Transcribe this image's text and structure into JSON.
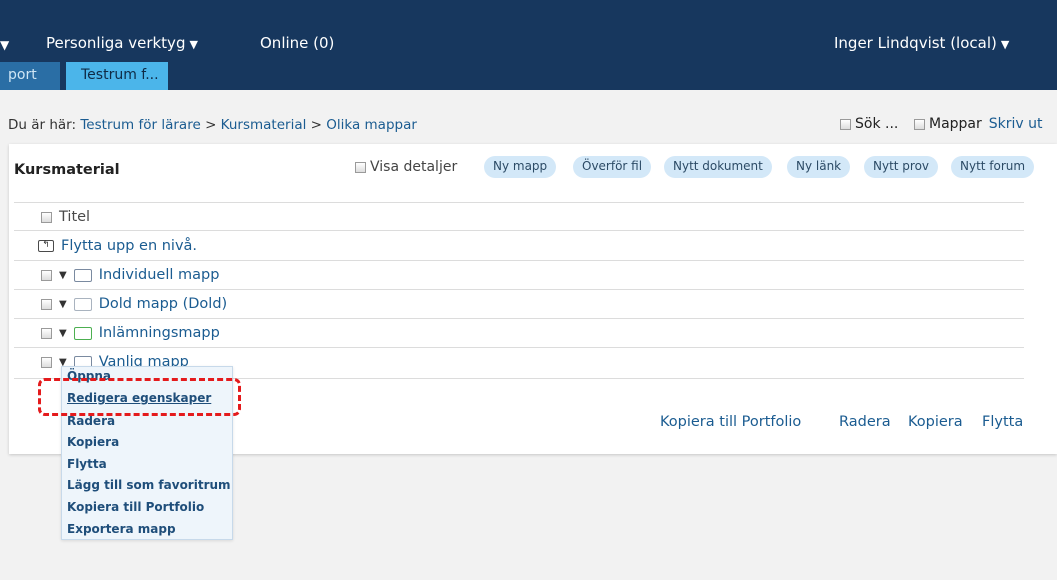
{
  "topnav": {
    "items": [
      {
        "label": "Personliga verktyg"
      },
      {
        "label": "Online (0)"
      }
    ],
    "user": "Inger Lindqvist (local)"
  },
  "tabs": [
    {
      "label": "port",
      "active": false
    },
    {
      "label": "Testrum f...",
      "active": true
    }
  ],
  "breadcrumb": {
    "prefix": "Du är här:",
    "items": [
      "Testrum för lärare",
      "Kursmaterial",
      "Olika mappar"
    ],
    "separator": ">"
  },
  "utilities": {
    "search": "Sök ...",
    "folders": "Mappar",
    "print": "Skriv ut"
  },
  "panel": {
    "title": "Kursmaterial",
    "show_details": "Visa detaljer",
    "buttons": [
      "Ny mapp",
      "Överför fil",
      "Nytt dokument",
      "Ny länk",
      "Nytt prov",
      "Nytt forum"
    ]
  },
  "list": {
    "header": "Titel",
    "up_level": "Flytta upp en nivå.",
    "items": [
      {
        "label": "Individuell mapp",
        "icon": "individual-folder-icon"
      },
      {
        "label": "Dold mapp (Dold)",
        "icon": "hidden-folder-icon"
      },
      {
        "label": "Inlämningsmapp",
        "icon": "submission-folder-icon"
      },
      {
        "label": "Vanlig mapp",
        "icon": "folder-icon"
      }
    ]
  },
  "bulk_actions": [
    "Kopiera till Portfolio",
    "Radera",
    "Kopiera",
    "Flytta"
  ],
  "context_menu": {
    "items": [
      "Öppna",
      "Redigera egenskaper",
      "Radera",
      "Kopiera",
      "Flytta",
      "Lägg till som favoritrum",
      "Kopiera till Portfolio",
      "Exportera mapp"
    ],
    "highlighted": "Redigera egenskaper"
  },
  "colors": {
    "topbar": "#17375e",
    "active_tab": "#4bb5ea",
    "link": "#1b5c91",
    "highlight": "#e41a1c"
  }
}
